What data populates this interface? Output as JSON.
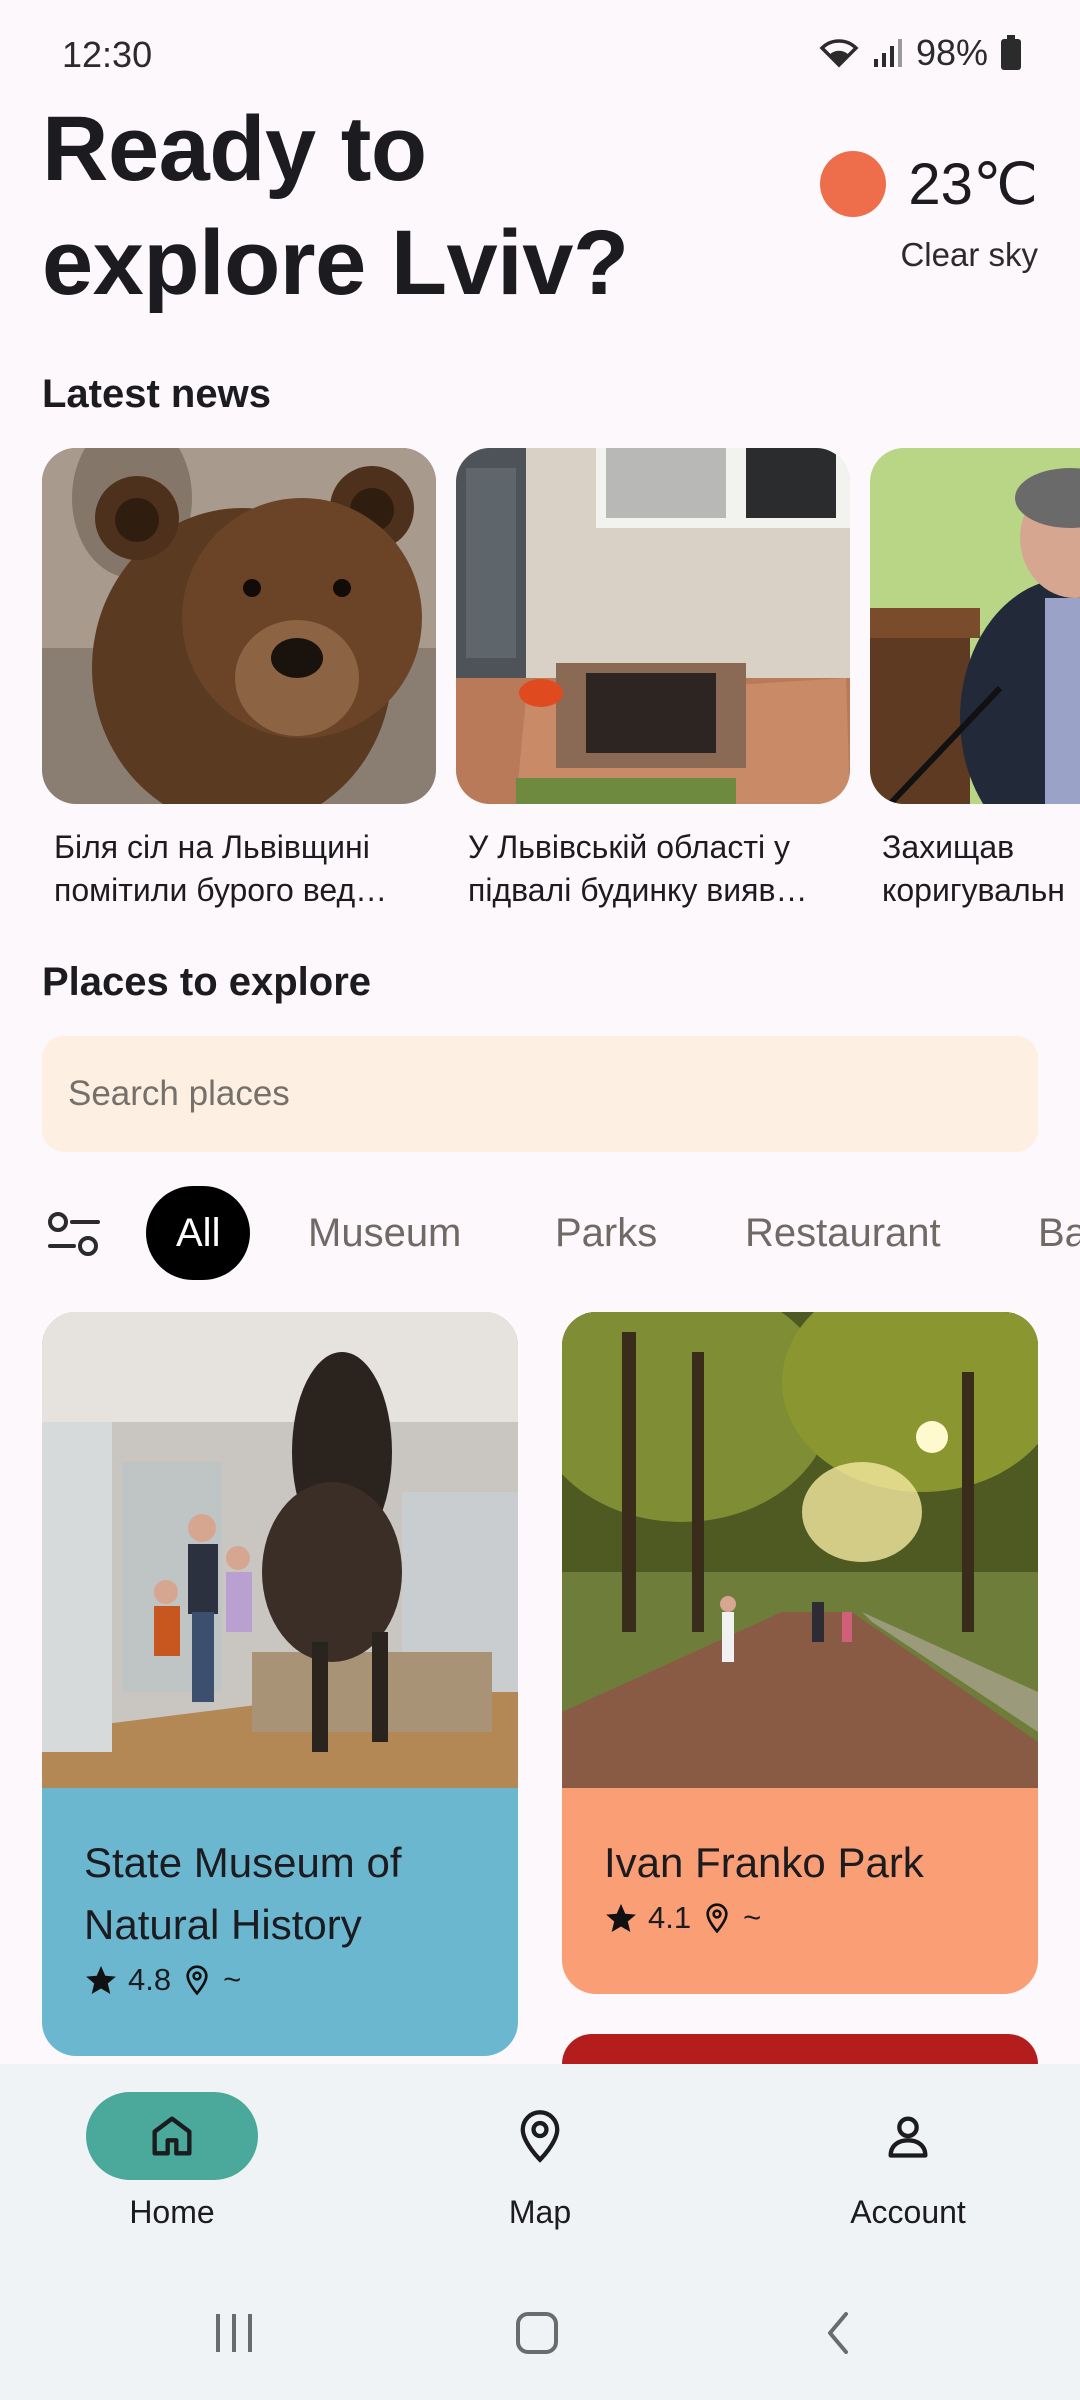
{
  "status_bar": {
    "time": "12:30",
    "battery": "98%"
  },
  "header": {
    "title_line1": "Ready to",
    "title_line2": "explore Lviv?",
    "weather": {
      "temperature": "23℃",
      "description": "Clear sky",
      "icon": "sun-icon",
      "icon_color": "#ee6e4b"
    }
  },
  "news": {
    "title": "Latest news",
    "items": [
      {
        "line1": "Біля сіл на Львівщині",
        "line2": "помітили бурого вед…",
        "image": "bear-photo"
      },
      {
        "line1": "У Львівській області у",
        "line2": "підвалі будинку вияв…",
        "image": "basement-photo"
      },
      {
        "line1": "Захищав",
        "line2": "коригувальн",
        "image": "speaker-photo"
      }
    ]
  },
  "places": {
    "title": "Places to explore",
    "search_placeholder": "Search places",
    "filters": [
      "All",
      "Museum",
      "Parks",
      "Restaurant",
      "Ba"
    ],
    "active_filter": "All",
    "items": [
      {
        "name_line1": "State Museum of",
        "name_line2": "Natural History",
        "rating": "4.8",
        "distance": "~",
        "color": "#6bb7d0"
      },
      {
        "name_line1": "Ivan Franko Park",
        "name_line2": "",
        "rating": "4.1",
        "distance": "~",
        "color": "#f99e75"
      }
    ]
  },
  "bottom_nav": {
    "items": [
      {
        "label": "Home",
        "icon": "home-icon",
        "active": true
      },
      {
        "label": "Map",
        "icon": "map-pin-icon",
        "active": false
      },
      {
        "label": "Account",
        "icon": "account-icon",
        "active": false
      }
    ],
    "active_color": "#4aa99a"
  }
}
